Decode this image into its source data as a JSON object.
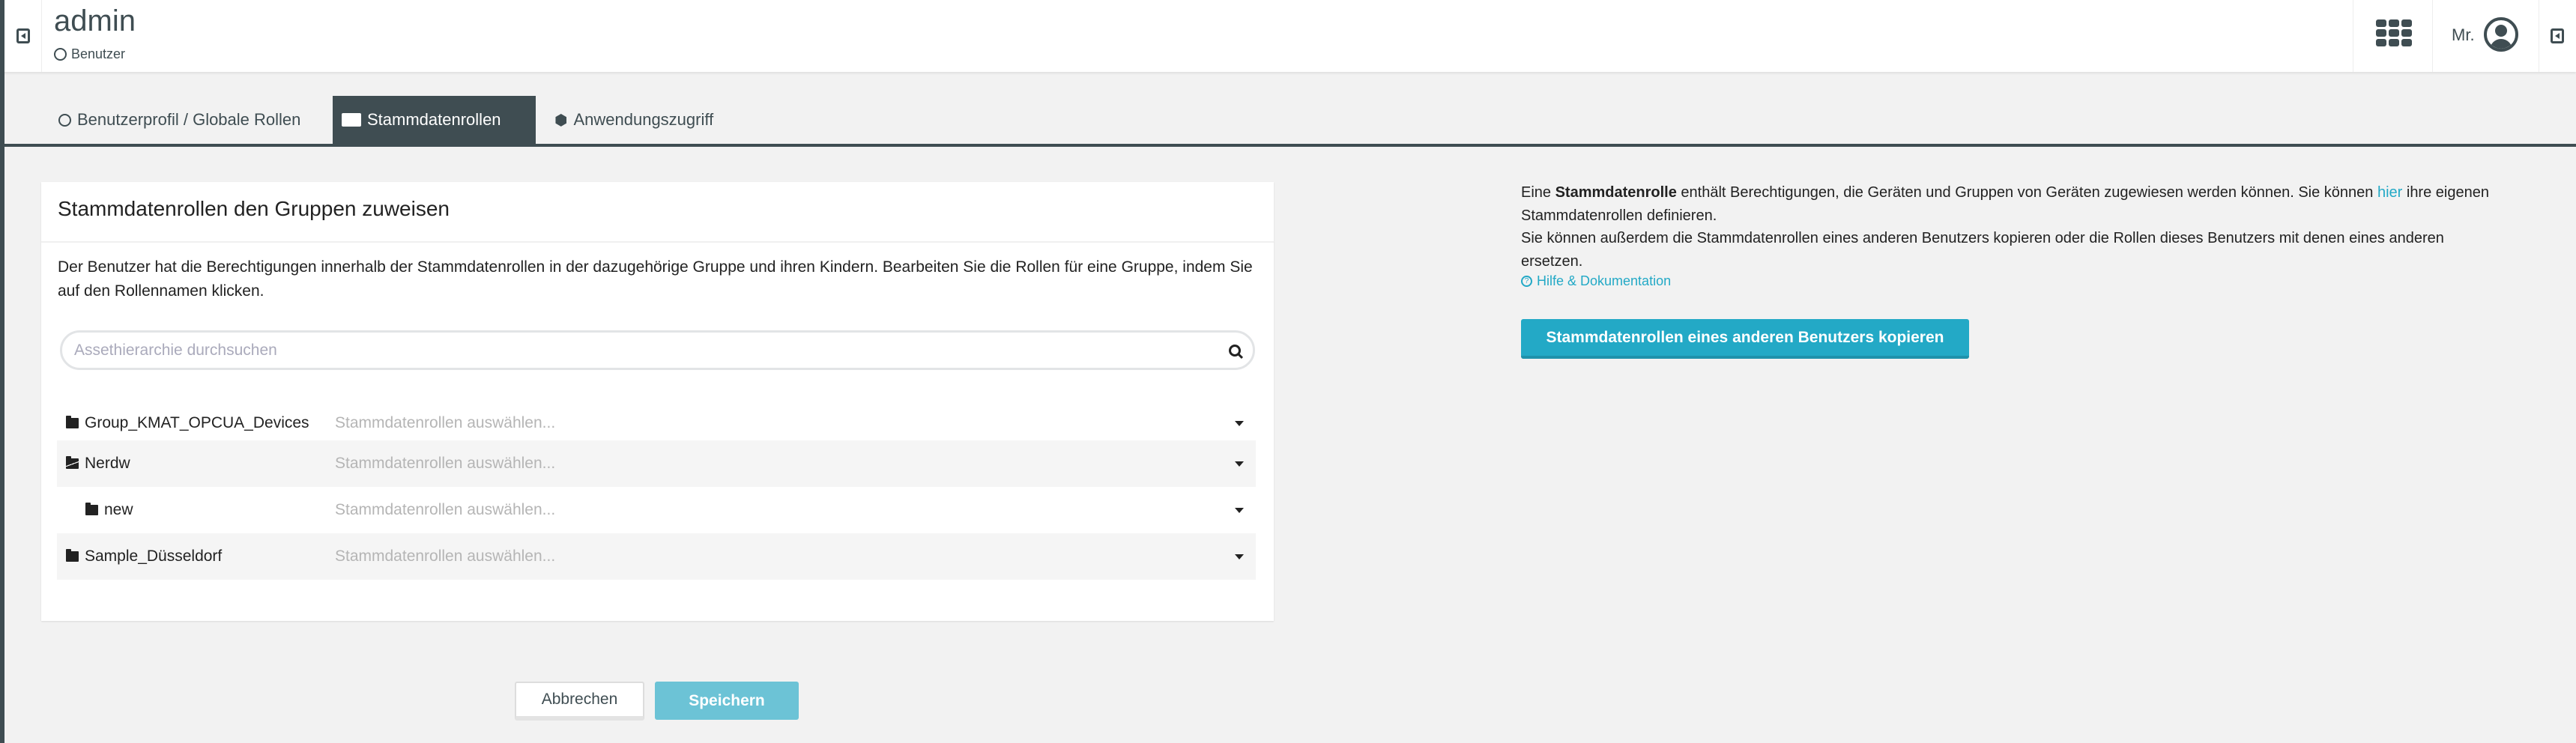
{
  "header": {
    "title": "admin",
    "breadcrumb": "Benutzer",
    "user_label": "Mr."
  },
  "tabs": [
    {
      "label": "Benutzerprofil / Globale Rollen"
    },
    {
      "label": "Stammdatenrollen"
    },
    {
      "label": "Anwendungszugriff"
    }
  ],
  "panel": {
    "title": "Stammdatenrollen den Gruppen zuweisen",
    "description": "Der Benutzer hat die Berechtigungen innerhalb der Stammdatenrollen in der dazugehörige Gruppe und ihren Kindern. Bearbeiten Sie die Rollen für eine Gruppe, indem Sie auf den Rollennamen klicken.",
    "search_placeholder": "Assethierarchie durchsuchen",
    "groups": [
      {
        "name": "Group_KMAT_OPCUA_Devices",
        "placeholder": "Stammdatenrollen auswählen..."
      },
      {
        "name": "Nerdw",
        "placeholder": "Stammdatenrollen auswählen..."
      },
      {
        "name": "new",
        "placeholder": "Stammdatenrollen auswählen..."
      },
      {
        "name": "Sample_Düsseldorf",
        "placeholder": "Stammdatenrollen auswählen..."
      }
    ]
  },
  "info": {
    "pre": "Eine ",
    "bold": "Stammdatenrolle",
    "mid": " enthält Berechtigungen, die Geräten und Gruppen von Geräten zugewiesen werden können. Sie können ",
    "link": "hier",
    "post": " ihre eigenen Stammdatenrollen definieren.",
    "line2": "Sie können außerdem die Stammdatenrollen eines anderen Benutzers kopieren oder die Rollen dieses Benutzers mit denen eines anderen ersetzen.",
    "help": "Hilfe & Dokumentation",
    "copy_button": "Stammdatenrollen eines anderen Benutzers kopieren"
  },
  "actions": {
    "cancel": "Abbrechen",
    "save": "Speichern"
  },
  "colors": {
    "accent": "#23a9c6",
    "dark": "#3f4d52"
  }
}
